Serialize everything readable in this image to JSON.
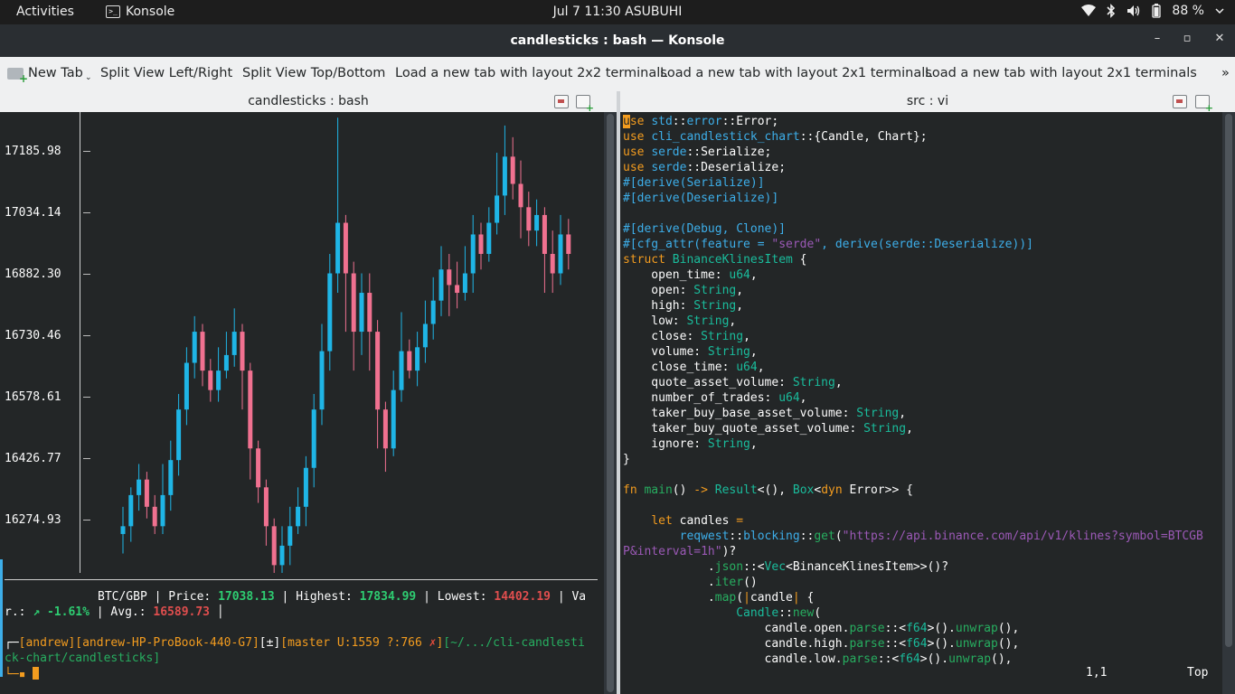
{
  "topbar": {
    "activities": "Activities",
    "app_name": "Konsole",
    "clock": "Jul 7  11:30 ASUBUHI",
    "battery": "88 %"
  },
  "window": {
    "title": "candlesticks : bash — Konsole"
  },
  "toolbar": {
    "new_tab": "New Tab",
    "items": [
      "Split View Left/Right",
      "Split View Top/Bottom",
      "Load a new tab with layout 2x2 terminals",
      "Load a new tab with layout 2x1 terminals",
      "Load a new tab with layout 2x1 terminals"
    ],
    "more": "»"
  },
  "left_pane": {
    "title": "candlesticks : bash",
    "y_labels": [
      "17185.98",
      "17034.14",
      "16882.30",
      "16730.46",
      "16578.61",
      "16426.77",
      "16274.93"
    ],
    "stats": {
      "pair": "BTC/GBP",
      "price_label": "Price:",
      "price": "17038.13",
      "highest_label": "Highest:",
      "highest": "17834.99",
      "lowest_label": "Lowest:",
      "lowest": "14402.19",
      "var_label_start": "Va",
      "var_label_end": "r.:",
      "var": "↗ -1.61%",
      "avg_label": "Avg.:",
      "avg": "16589.73"
    },
    "prompt": {
      "line1_pre": "┌─",
      "user": "[andrew]",
      "host": "[andrew-HP-ProBook-440-G7]",
      "pm": "[±]",
      "git_pre": "[master U:1559 ?:766 ",
      "git_x": "✗",
      "git_post": "]",
      "path_a": "[~/.../cli-candlesti",
      "path_b": "ck-chart/candlesticks]",
      "line3": "└─▪ "
    }
  },
  "right_pane": {
    "title": "src : vi",
    "status_pos": "1,1",
    "status_top": "Top"
  },
  "chart_data": {
    "type": "candlestick",
    "y_tick_labels": [
      "17185.98",
      "17034.14",
      "16882.30",
      "16730.46",
      "16578.61",
      "16426.77",
      "16274.93"
    ],
    "ylim": [
      16180,
      17360
    ],
    "colors": {
      "up": "#1fb5e6",
      "down": "#f07190"
    },
    "candles": [
      [
        16280,
        16300,
        16350,
        16230
      ],
      [
        16300,
        16380,
        16400,
        16260
      ],
      [
        16380,
        16420,
        16460,
        16340
      ],
      [
        16420,
        16350,
        16440,
        16320
      ],
      [
        16350,
        16300,
        16380,
        16280
      ],
      [
        16300,
        16380,
        16460,
        16280
      ],
      [
        16380,
        16470,
        16520,
        16340
      ],
      [
        16470,
        16600,
        16640,
        16430
      ],
      [
        16600,
        16720,
        16760,
        16560
      ],
      [
        16720,
        16800,
        16840,
        16680
      ],
      [
        16800,
        16700,
        16820,
        16660
      ],
      [
        16700,
        16650,
        16730,
        16620
      ],
      [
        16650,
        16700,
        16760,
        16620
      ],
      [
        16700,
        16740,
        16800,
        16680
      ],
      [
        16740,
        16800,
        16860,
        16710
      ],
      [
        16800,
        16700,
        16820,
        16600
      ],
      [
        16700,
        16500,
        16720,
        16420
      ],
      [
        16500,
        16400,
        16520,
        16360
      ],
      [
        16400,
        16300,
        16420,
        16250
      ],
      [
        16300,
        16200,
        16320,
        16150
      ],
      [
        16200,
        16250,
        16300,
        16140
      ],
      [
        16250,
        16300,
        16350,
        16200
      ],
      [
        16300,
        16350,
        16400,
        16280
      ],
      [
        16350,
        16450,
        16480,
        16300
      ],
      [
        16450,
        16600,
        16640,
        16400
      ],
      [
        16600,
        16750,
        16820,
        16560
      ],
      [
        16750,
        16950,
        17000,
        16700
      ],
      [
        16950,
        17080,
        17350,
        16900
      ],
      [
        17080,
        16950,
        17100,
        16800
      ],
      [
        16950,
        16800,
        16980,
        16700
      ],
      [
        16800,
        16900,
        16950,
        16740
      ],
      [
        16900,
        16800,
        16950,
        16700
      ],
      [
        16800,
        16600,
        16830,
        16500
      ],
      [
        16600,
        16500,
        16620,
        16440
      ],
      [
        16500,
        16650,
        16700,
        16480
      ],
      [
        16650,
        16750,
        16850,
        16620
      ],
      [
        16750,
        16700,
        16780,
        16680
      ],
      [
        16700,
        16760,
        16800,
        16660
      ],
      [
        16760,
        16820,
        16880,
        16720
      ],
      [
        16820,
        16880,
        16940,
        16780
      ],
      [
        16880,
        16960,
        17020,
        16840
      ],
      [
        16960,
        16920,
        17000,
        16840
      ],
      [
        16920,
        16900,
        16980,
        16860
      ],
      [
        16900,
        16950,
        17020,
        16880
      ],
      [
        16950,
        17050,
        17100,
        16900
      ],
      [
        17050,
        17000,
        17080,
        16960
      ],
      [
        17000,
        17080,
        17120,
        16980
      ],
      [
        17080,
        17150,
        17260,
        17050
      ],
      [
        17150,
        17250,
        17330,
        17100
      ],
      [
        17250,
        17180,
        17300,
        17140
      ],
      [
        17180,
        17120,
        17240,
        17040
      ],
      [
        17120,
        17060,
        17160,
        17020
      ],
      [
        17060,
        17100,
        17140,
        17020
      ],
      [
        17100,
        17000,
        17120,
        16900
      ],
      [
        17000,
        16950,
        17060,
        16900
      ],
      [
        16950,
        17050,
        17100,
        16920
      ],
      [
        17050,
        17000,
        17090,
        16960
      ]
    ]
  }
}
